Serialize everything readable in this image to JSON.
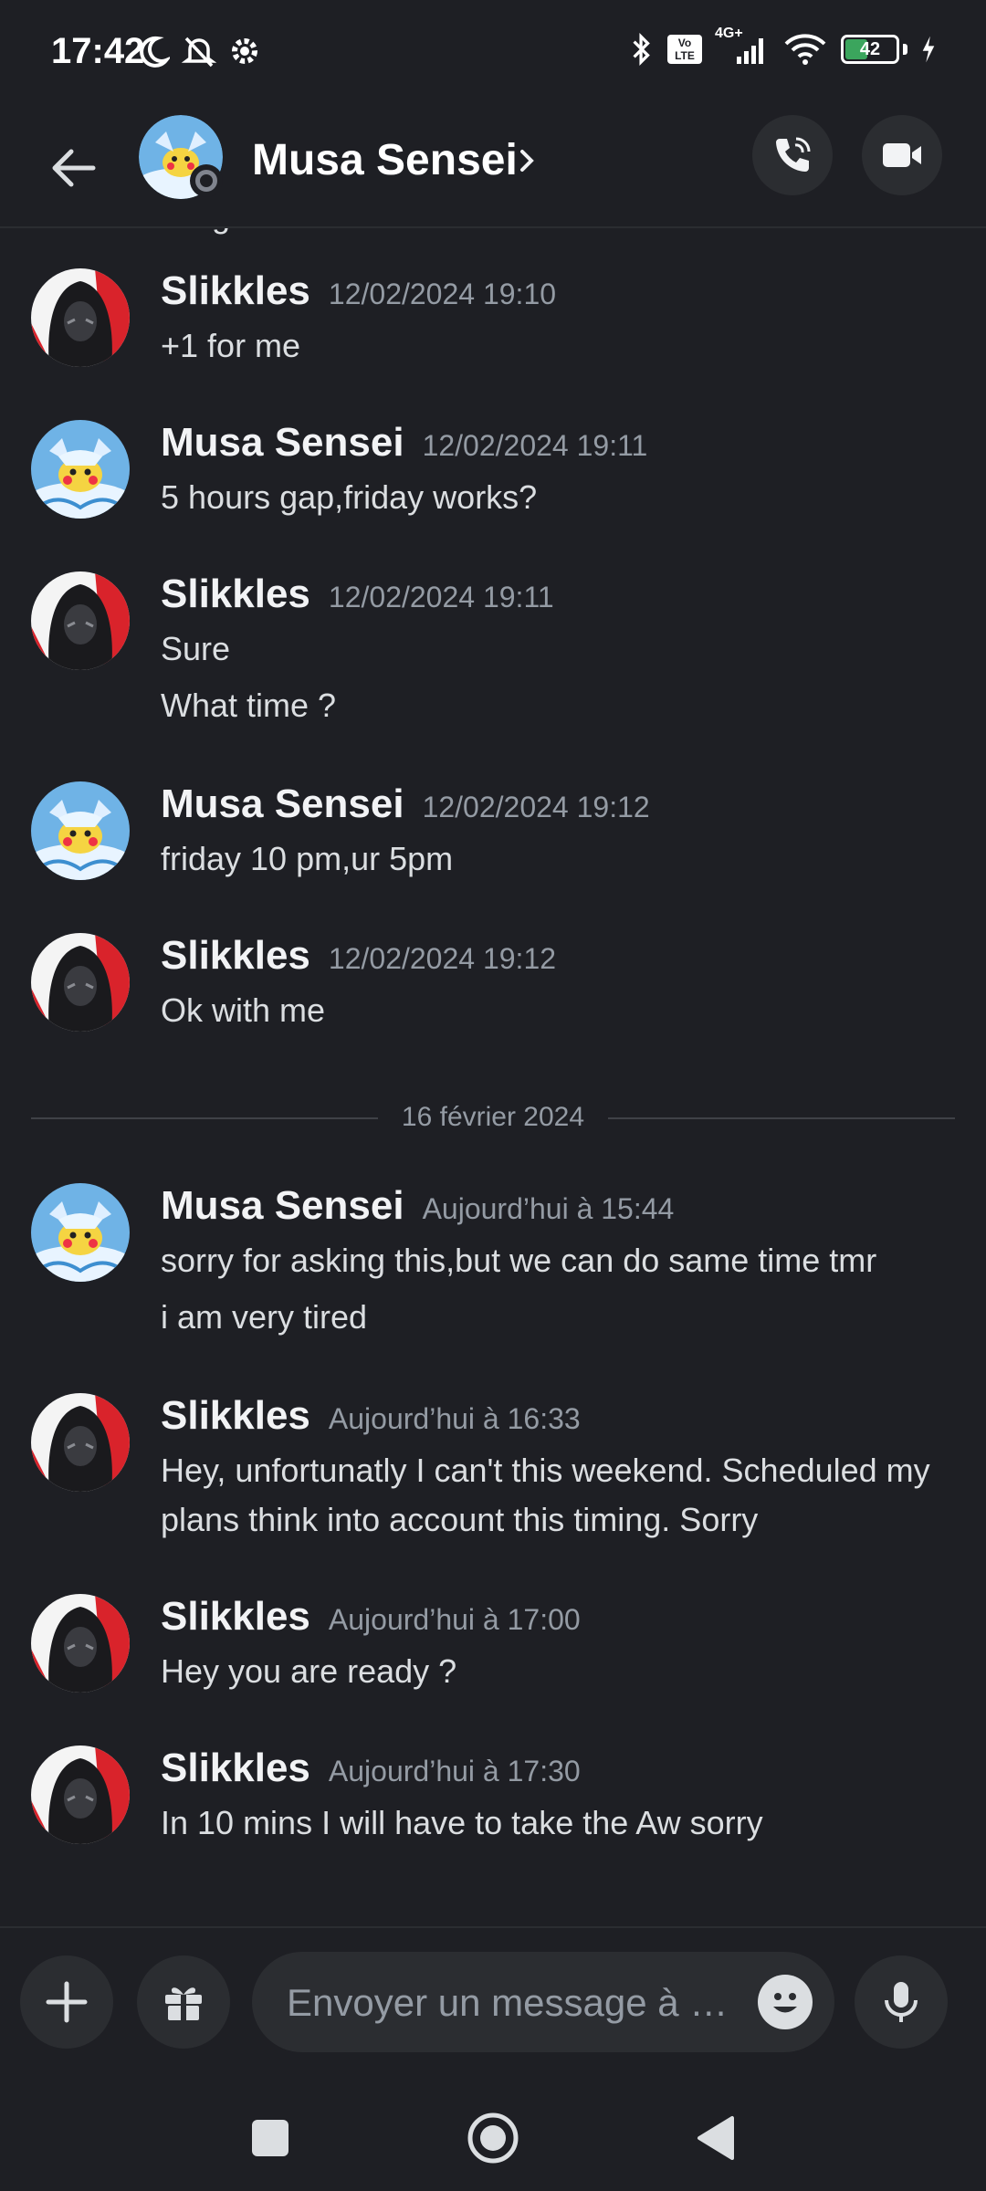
{
  "status_bar": {
    "time": "17:42",
    "network": "4G+",
    "volte": "Vo LTE",
    "battery": "42",
    "battery_level": 0.42,
    "icons": [
      "moon-icon",
      "silent-icon",
      "settings-icon",
      "bluetooth-icon",
      "signal-icon",
      "wifi-icon",
      "battery-icon",
      "charging-icon"
    ]
  },
  "header": {
    "contact_name": "Musa Sensei",
    "icons": [
      "back-arrow-icon",
      "chevron-right-icon",
      "phone-call-icon",
      "video-camera-icon"
    ]
  },
  "messages": {
    "clipped_text": "…ng",
    "items": [
      {
        "author": "Slikkles",
        "avatar": "slikkles",
        "time": "12/02/2024 19:10",
        "lines": [
          "+1 for me"
        ]
      },
      {
        "author": "Musa Sensei",
        "avatar": "musa",
        "time": "12/02/2024 19:11",
        "lines": [
          "5 hours gap,friday works?"
        ]
      },
      {
        "author": "Slikkles",
        "avatar": "slikkles",
        "time": "12/02/2024 19:11",
        "lines": [
          "Sure",
          "What time ?"
        ]
      },
      {
        "author": "Musa Sensei",
        "avatar": "musa",
        "time": "12/02/2024 19:12",
        "lines": [
          "friday 10 pm,ur 5pm"
        ]
      },
      {
        "author": "Slikkles",
        "avatar": "slikkles",
        "time": "12/02/2024 19:12",
        "lines": [
          "Ok with me"
        ]
      },
      {
        "author": "Musa Sensei",
        "avatar": "musa",
        "time": "Aujourd’hui à 15:44",
        "lines": [
          "sorry for asking this,but we can do same time tmr",
          "i am very tired"
        ]
      },
      {
        "author": "Slikkles",
        "avatar": "slikkles",
        "time": "Aujourd’hui à 16:33",
        "lines": [
          "Hey, unfortunatly I can't this weekend. Scheduled my plans think into account this timing. Sorry"
        ]
      },
      {
        "author": "Slikkles",
        "avatar": "slikkles",
        "time": "Aujourd’hui à 17:00",
        "lines": [
          "Hey you are ready ?"
        ]
      },
      {
        "author": "Slikkles",
        "avatar": "slikkles",
        "time": "Aujourd’hui à 17:30",
        "lines": [
          "In 10 mins I will have to take the Aw sorry"
        ]
      }
    ],
    "date_divider": "16 février 2024"
  },
  "composer": {
    "placeholder": "Envoyer un message à …",
    "icons": [
      "plus-icon",
      "gift-icon",
      "emoji-icon",
      "microphone-icon"
    ]
  },
  "nav_bar": {
    "icons": [
      "recents-square-icon",
      "home-circle-icon",
      "back-triangle-icon"
    ]
  },
  "colors": {
    "background": "#1e1f24",
    "surface": "#2b2d31",
    "text": "#f2f3f5",
    "muted": "#949ba4",
    "battery_green": "#3ba55d"
  }
}
